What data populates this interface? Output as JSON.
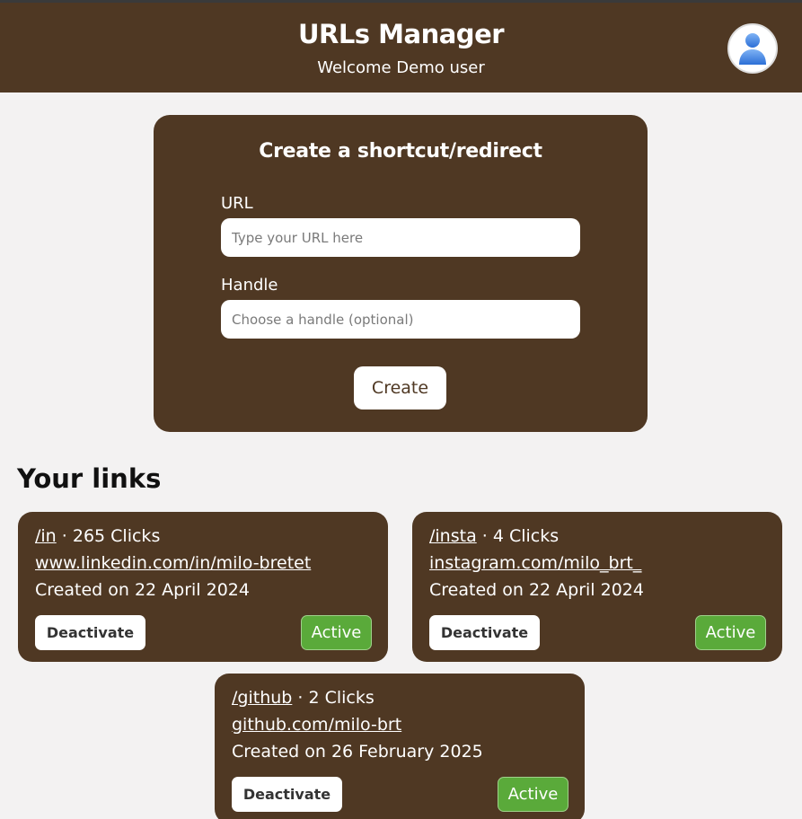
{
  "header": {
    "title": "URLs Manager",
    "subtitle": "Welcome Demo user",
    "avatar_icon": "user-avatar-icon"
  },
  "form": {
    "title": "Create a shortcut/redirect",
    "url_label": "URL",
    "url_placeholder": "Type your URL here",
    "url_value": "",
    "handle_label": "Handle",
    "handle_placeholder": "Choose a handle (optional)",
    "handle_value": "",
    "create_label": "Create"
  },
  "links": {
    "title": "Your links",
    "items": [
      {
        "handle": "/in",
        "clicks": "· 265 Clicks",
        "url": "www.linkedin.com/in/milo-bretet",
        "created": "Created on 22 April 2024",
        "deactivate_label": "Deactivate",
        "status": "Active"
      },
      {
        "handle": "/insta",
        "clicks": "· 4 Clicks",
        "url": "instagram.com/milo_brt_",
        "created": "Created on 22 April 2024",
        "deactivate_label": "Deactivate",
        "status": "Active"
      },
      {
        "handle": "/github",
        "clicks": "· 2 Clicks",
        "url": "github.com/milo-brt",
        "created": "Created on 26 February 2025",
        "deactivate_label": "Deactivate",
        "status": "Active"
      }
    ]
  },
  "colors": {
    "brand_brown": "#4f3823",
    "background": "#f3f2f2",
    "active_green": "#5aaa3a"
  }
}
